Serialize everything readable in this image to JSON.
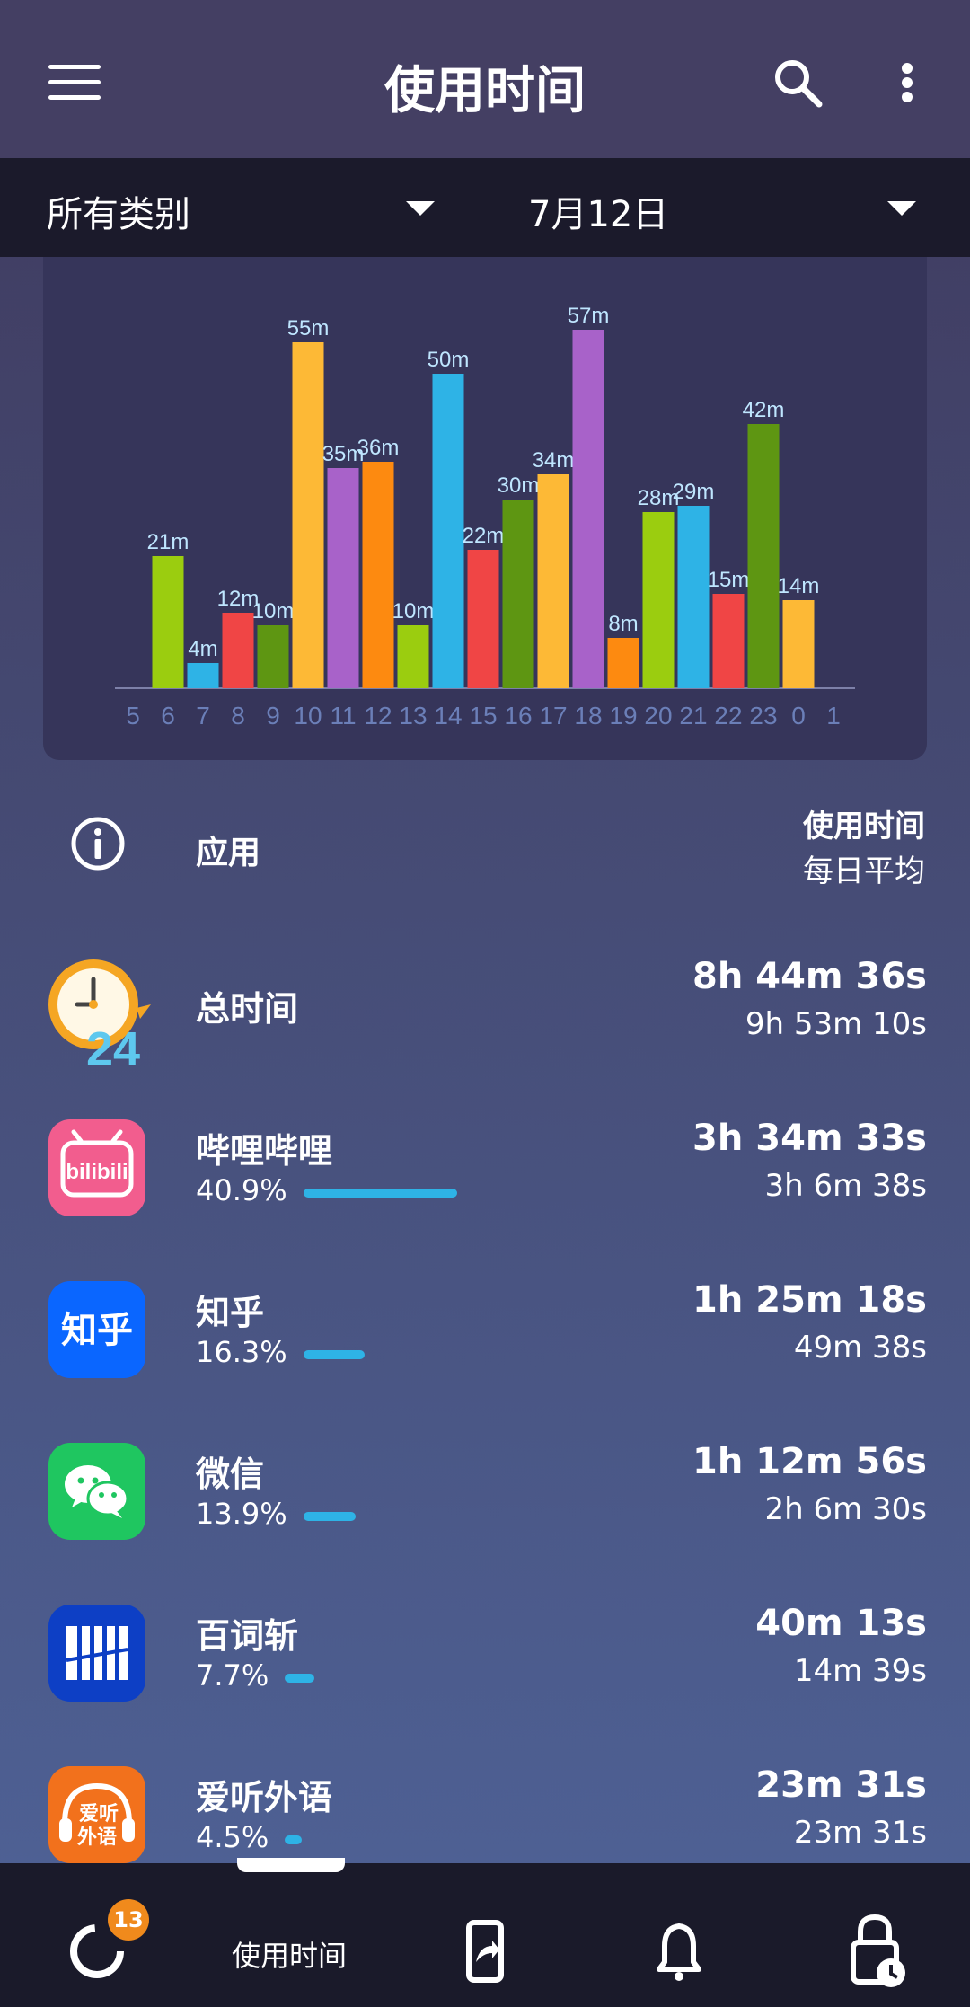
{
  "header": {
    "title": "使用时间"
  },
  "filters": {
    "category": "所有类别",
    "date": "7月12日"
  },
  "chart_data": {
    "type": "bar",
    "categories": [
      "5",
      "6",
      "7",
      "8",
      "9",
      "10",
      "11",
      "12",
      "13",
      "14",
      "15",
      "16",
      "17",
      "18",
      "19",
      "20",
      "21",
      "22",
      "23",
      "0",
      "1"
    ],
    "values": [
      0,
      21,
      4,
      12,
      10,
      55,
      35,
      36,
      10,
      50,
      22,
      30,
      34,
      57,
      8,
      28,
      29,
      15,
      42,
      14,
      0
    ],
    "labels": [
      "",
      "21m",
      "4m",
      "12m",
      "10m",
      "55m",
      "35m",
      "36m",
      "10m",
      "50m",
      "22m",
      "30m",
      "34m",
      "57m",
      "8m",
      "28m",
      "29m",
      "15m",
      "42m",
      "14m",
      ""
    ],
    "colors": [
      "#9bcd0f",
      "#9bcd0f",
      "#2eb3e6",
      "#f04545",
      "#5e9612",
      "#fdb936",
      "#a862c9",
      "#fd8a10",
      "#9bcd0f",
      "#2eb3e6",
      "#f04545",
      "#5e9612",
      "#fdb936",
      "#a862c9",
      "#fd8a10",
      "#9bcd0f",
      "#2eb3e6",
      "#f04545",
      "#5e9612",
      "#fdb936",
      "#a862c9"
    ],
    "ylim": [
      0,
      60
    ],
    "title": "",
    "xlabel": "",
    "ylabel": ""
  },
  "table_header": {
    "app": "应用",
    "time": "使用时间",
    "avg": "每日平均"
  },
  "total": {
    "name": "总时间",
    "time": "8h 44m 36s",
    "avg": "9h 53m 10s",
    "icon": "clock-24-icon"
  },
  "apps": [
    {
      "name": "哔哩哔哩",
      "pct": "40.9%",
      "share": 0.409,
      "time": "3h 34m 33s",
      "avg": "3h 6m 38s",
      "icon": "bilibili-icon",
      "icon_text": "bilibili",
      "color": "#f25d8e"
    },
    {
      "name": "知乎",
      "pct": "16.3%",
      "share": 0.163,
      "time": "1h 25m 18s",
      "avg": "49m 38s",
      "icon": "zhihu-icon",
      "icon_text": "知乎",
      "color": "#0a66ff"
    },
    {
      "name": "微信",
      "pct": "13.9%",
      "share": 0.139,
      "time": "1h 12m 56s",
      "avg": "2h 6m 30s",
      "icon": "wechat-icon",
      "color": "#1fc660"
    },
    {
      "name": "百词斩",
      "pct": "7.7%",
      "share": 0.077,
      "time": "40m 13s",
      "avg": "14m 39s",
      "icon": "baicizhan-icon",
      "color": "#0d3fc5"
    },
    {
      "name": "爱听外语",
      "pct": "4.5%",
      "share": 0.045,
      "time": "23m 31s",
      "avg": "23m 31s",
      "icon": "aitingwaiyu-icon",
      "icon_text": "爱听外语",
      "color": "#f2711c"
    }
  ],
  "bottom_nav": {
    "badge": "13",
    "active_label": "使用时间",
    "items": [
      "stats-ring-icon",
      "usage-time-tab",
      "phone-share-icon",
      "bell-icon",
      "lock-clock-icon"
    ]
  }
}
